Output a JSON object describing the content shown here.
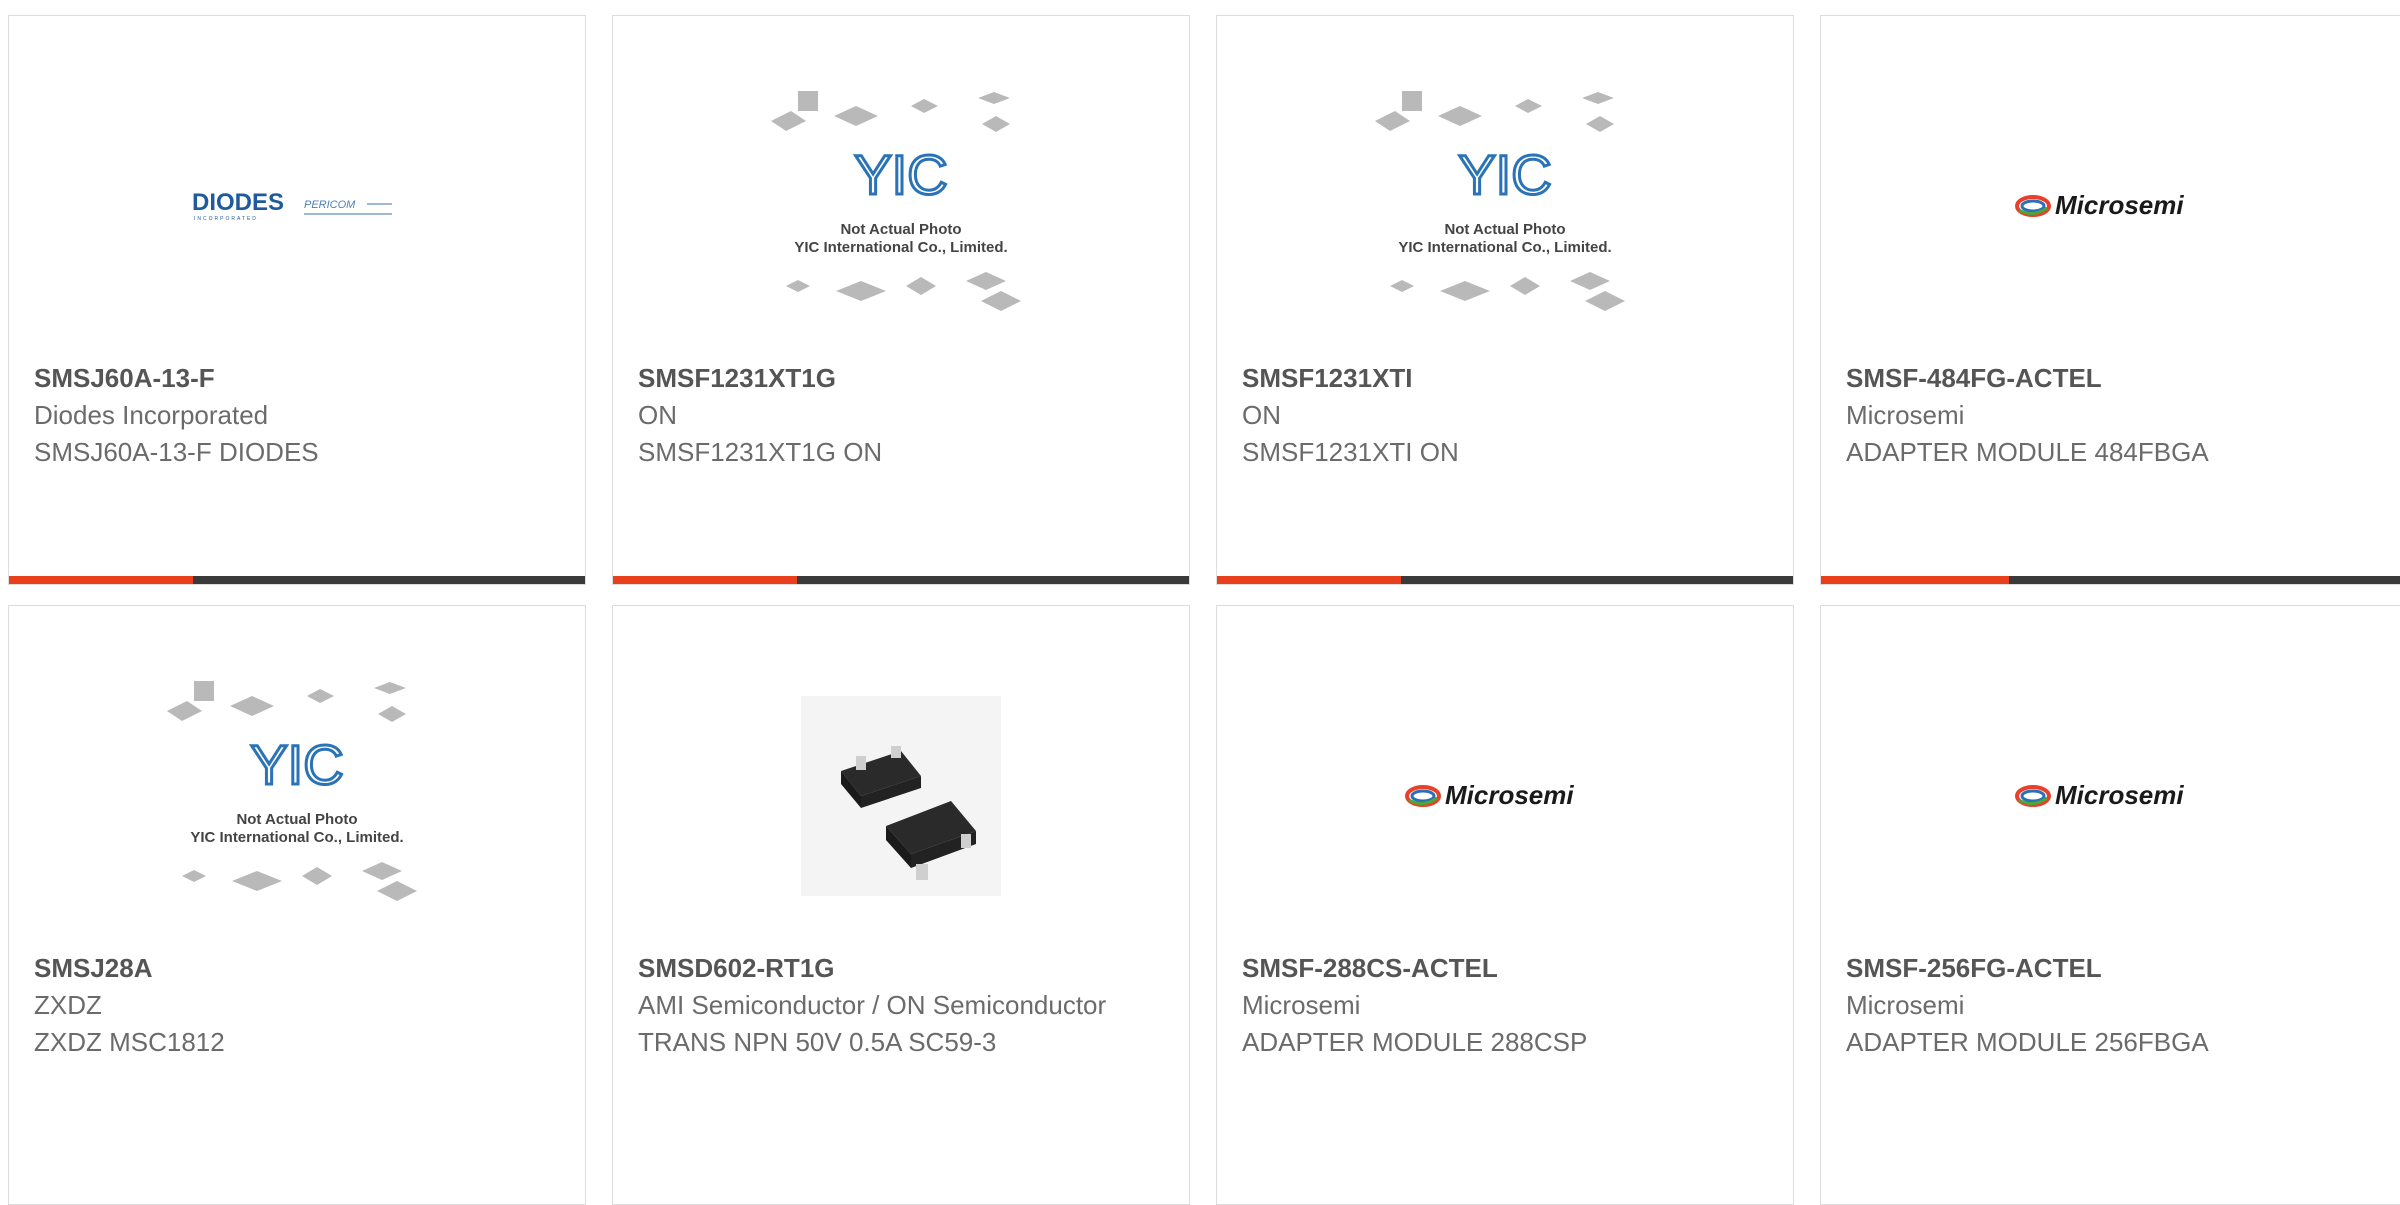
{
  "colors": {
    "accent": "#e8401c",
    "bar": "#3a3a3a",
    "border": "#dcdcdc"
  },
  "placeholder": {
    "line1": "Not Actual Photo",
    "line2": "YIC International Co., Limited.",
    "logo": "YIC"
  },
  "logos": {
    "diodes": "DIODES",
    "diodes_sub": "INCORPORATED",
    "pericom": "PERICOM",
    "microsemi": "Microsemi"
  },
  "products": [
    {
      "part": "SMSJ60A-13-F",
      "manufacturer": "Diodes Incorporated",
      "description": "SMSJ60A-13-F DIODES",
      "image": "diodes-logo"
    },
    {
      "part": "SMSF1231XT1G",
      "manufacturer": "ON",
      "description": "SMSF1231XT1G ON",
      "image": "yic-placeholder"
    },
    {
      "part": "SMSF1231XTI",
      "manufacturer": "ON",
      "description": "SMSF1231XTI ON",
      "image": "yic-placeholder"
    },
    {
      "part": "SMSF-484FG-ACTEL",
      "manufacturer": "Microsemi",
      "description": "ADAPTER MODULE 484FBGA",
      "image": "microsemi-logo"
    },
    {
      "part": "SMSJ28A",
      "manufacturer": "ZXDZ",
      "description": "ZXDZ MSC1812",
      "image": "yic-placeholder"
    },
    {
      "part": "SMSD602-RT1G",
      "manufacturer": "AMI Semiconductor / ON Semiconductor",
      "description": "TRANS NPN 50V 0.5A SC59-3",
      "image": "sot-package-photo"
    },
    {
      "part": "SMSF-288CS-ACTEL",
      "manufacturer": "Microsemi",
      "description": "ADAPTER MODULE 288CSP",
      "image": "microsemi-logo"
    },
    {
      "part": "SMSF-256FG-ACTEL",
      "manufacturer": "Microsemi",
      "description": "ADAPTER MODULE 256FBGA",
      "image": "microsemi-logo"
    }
  ]
}
